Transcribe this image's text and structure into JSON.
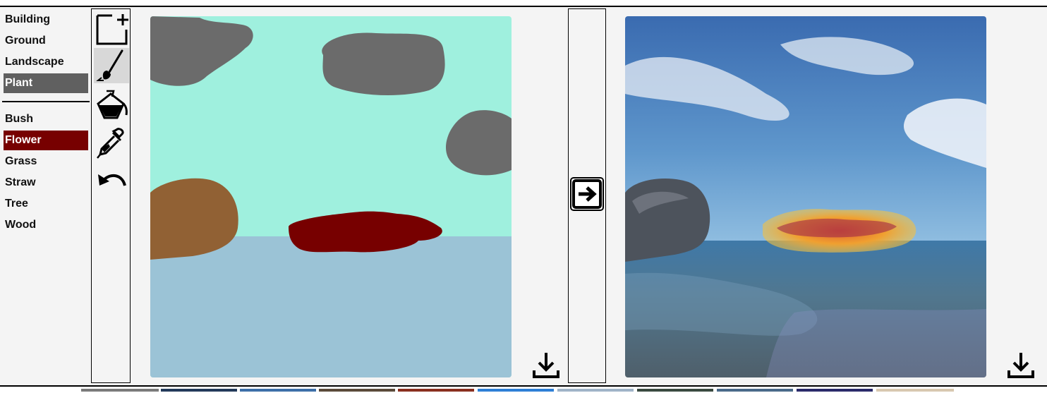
{
  "categories": {
    "main": [
      {
        "label": "Building",
        "name": "category-building"
      },
      {
        "label": "Ground",
        "name": "category-ground"
      },
      {
        "label": "Landscape",
        "name": "category-landscape"
      },
      {
        "label": "Plant",
        "name": "category-plant",
        "selected": true
      }
    ],
    "sub": [
      {
        "label": "Bush",
        "name": "subcategory-bush"
      },
      {
        "label": "Flower",
        "name": "subcategory-flower",
        "selected": true
      },
      {
        "label": "Grass",
        "name": "subcategory-grass"
      },
      {
        "label": "Straw",
        "name": "subcategory-straw"
      },
      {
        "label": "Tree",
        "name": "subcategory-tree"
      },
      {
        "label": "Wood",
        "name": "subcategory-wood"
      }
    ]
  },
  "tools": [
    {
      "name": "new-canvas-tool",
      "icon": "new-canvas-icon"
    },
    {
      "name": "brush-tool",
      "icon": "brush-icon",
      "active": true
    },
    {
      "name": "fill-tool",
      "icon": "paint-bucket-icon"
    },
    {
      "name": "eyedropper-tool",
      "icon": "eyedropper-icon"
    },
    {
      "name": "undo-tool",
      "icon": "undo-icon"
    }
  ],
  "colors": {
    "sky": "#9ff0de",
    "sea": "#9bc3d6",
    "rock": "#6b6b6b",
    "wood": "#916134",
    "flower": "#770000",
    "selected_main": "#606060"
  },
  "icons": {
    "download_segmentation": "download-icon",
    "download_output": "download-icon",
    "generate": "arrow-right-icon"
  }
}
